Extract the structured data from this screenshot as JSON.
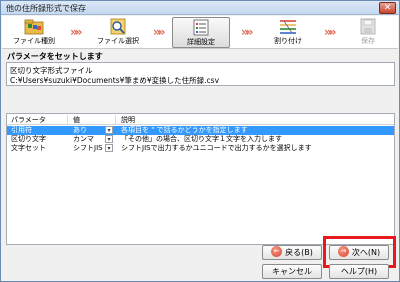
{
  "window": {
    "title": "他の住所録形式で保存",
    "close_label": "✕"
  },
  "steps": [
    {
      "label": "ファイル種別",
      "icon": "folder-icon",
      "state": "normal"
    },
    {
      "label": "ファイル選択",
      "icon": "search-file-icon",
      "state": "normal"
    },
    {
      "label": "詳細設定",
      "icon": "settings-list-icon",
      "state": "active"
    },
    {
      "label": "割り付け",
      "icon": "mapping-icon",
      "state": "normal"
    },
    {
      "label": "保存",
      "icon": "disk-icon",
      "state": "disabled"
    }
  ],
  "step_arrow": "»»",
  "param": {
    "heading": "パラメータをセットします",
    "file_type": "区切り文字形式ファイル",
    "file_path": "C:¥Users¥suzuki¥Documents¥筆まめ¥変換した住所録.csv"
  },
  "table": {
    "headers": {
      "param": "パラメータ",
      "value": "値",
      "desc": "説明"
    },
    "rows": [
      {
        "param": "引用符",
        "value": "あり",
        "desc": "各項目を \" で括るかどうかを指定します",
        "selected": true
      },
      {
        "param": "区切り文字",
        "value": "カンマ",
        "desc": "「その他」の場合、区切り文字１文字を入力します",
        "selected": false
      },
      {
        "param": "文字セット",
        "value": "シフトJIS",
        "desc": "シフトJISで出力するかユニコードで出力するかを選択します",
        "selected": false
      }
    ],
    "dropdown_glyph": "▾"
  },
  "buttons": {
    "back": {
      "label": "戻る(B)",
      "icon": "left-arrow-icon",
      "glyph": "←"
    },
    "next": {
      "label": "次へ(N)",
      "icon": "right-arrow-icon",
      "glyph": "→"
    },
    "cancel": {
      "label": "キャンセル"
    },
    "help": {
      "label": "ヘルプ(H)"
    }
  },
  "colors": {
    "selection": "#3399ff",
    "highlight": "#e8181e",
    "arrow": "#e06c5a"
  }
}
